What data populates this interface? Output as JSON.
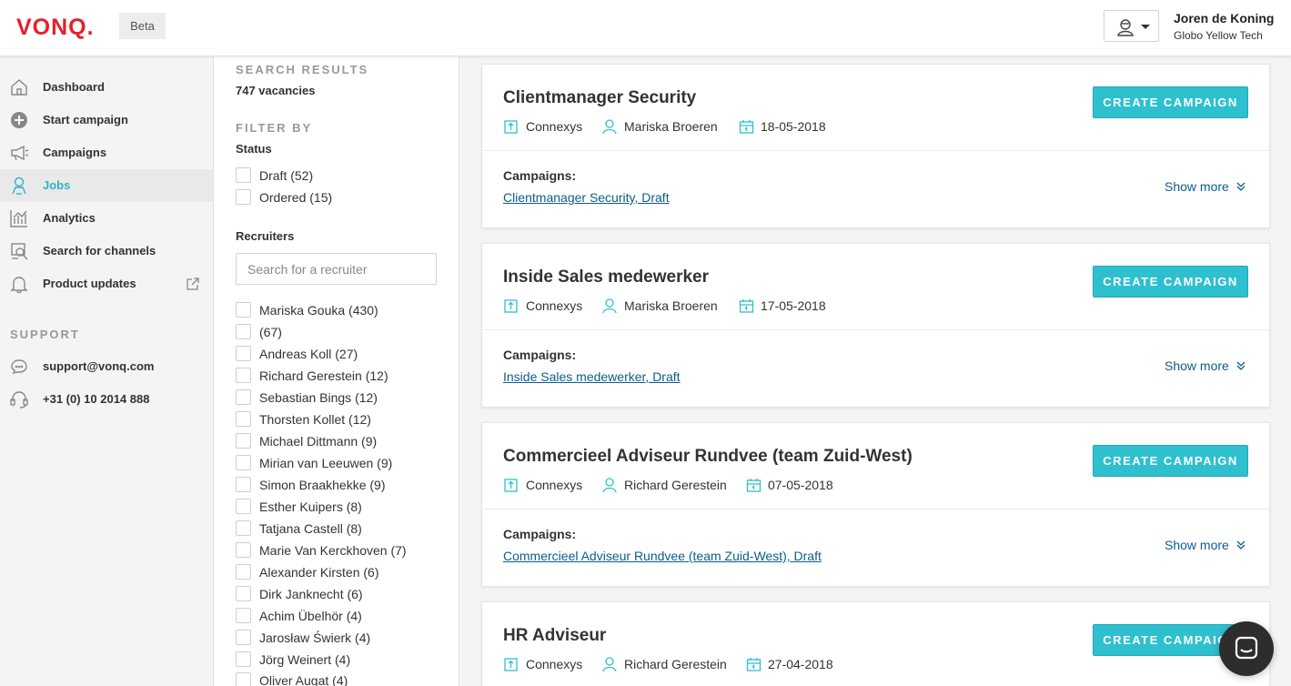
{
  "brand": {
    "logo": "VONQ.",
    "badge": "Beta"
  },
  "user": {
    "name": "Joren de Koning",
    "company": "Globo Yellow Tech"
  },
  "sidebar": {
    "items": [
      {
        "label": "Dashboard",
        "icon": "home-icon"
      },
      {
        "label": "Start campaign",
        "icon": "plus-circle-icon"
      },
      {
        "label": "Campaigns",
        "icon": "megaphone-icon"
      },
      {
        "label": "Jobs",
        "icon": "briefcase-person-icon",
        "active": true
      },
      {
        "label": "Analytics",
        "icon": "bar-chart-icon"
      },
      {
        "label": "Search for channels",
        "icon": "search-channels-icon"
      },
      {
        "label": "Product updates",
        "icon": "bell-icon"
      }
    ],
    "support_heading": "SUPPORT",
    "support_items": [
      {
        "label": "support@vonq.com",
        "icon": "chat-icon"
      },
      {
        "label": "+31 (0) 10 2014 888",
        "icon": "headset-icon"
      }
    ]
  },
  "filters": {
    "results_heading": "SEARCH RESULTS",
    "results_count": "747 vacancies",
    "filter_heading": "FILTER BY",
    "status_label": "Status",
    "status_options": [
      "Draft (52)",
      "Ordered (15)"
    ],
    "recruiters_label": "Recruiters",
    "recruiter_search_placeholder": "Search for a recruiter",
    "recruiters": [
      "Mariska Gouka (430)",
      "(67)",
      "Andreas Koll (27)",
      "Richard Gerestein (12)",
      "Sebastian Bings (12)",
      "Thorsten Kollet (12)",
      "Michael Dittmann (9)",
      "Mirian van Leeuwen (9)",
      "Simon Braakhekke (9)",
      "Esther Kuipers (8)",
      "Tatjana Castell (8)",
      "Marie Van Kerckhoven (7)",
      "Alexander Kirsten (6)",
      "Dirk Janknecht (6)",
      "Achim Übelhör (4)",
      "Jarosław Świerk (4)",
      "Jörg Weinert (4)",
      "Oliver Augat (4)"
    ]
  },
  "jobs": [
    {
      "title": "Clientmanager Security",
      "company": "Connexys",
      "recruiter": "Mariska Broeren",
      "date": "18-05-2018",
      "button": "CREATE CAMPAIGN",
      "campaigns_label": "Campaigns:",
      "campaign_link": "Clientmanager Security, Draft",
      "show_more": "Show more"
    },
    {
      "title": "Inside Sales medewerker",
      "company": "Connexys",
      "recruiter": "Mariska Broeren",
      "date": "17-05-2018",
      "button": "CREATE CAMPAIGN",
      "campaigns_label": "Campaigns:",
      "campaign_link": "Inside Sales medewerker, Draft",
      "show_more": "Show more"
    },
    {
      "title": "Commercieel Adviseur Rundvee (team Zuid-West)",
      "company": "Connexys",
      "recruiter": "Richard Gerestein",
      "date": "07-05-2018",
      "button": "CREATE CAMPAIGN",
      "campaigns_label": "Campaigns:",
      "campaign_link": "Commercieel Adviseur Rundvee (team Zuid-West), Draft",
      "show_more": "Show more"
    },
    {
      "title": "HR Adviseur",
      "company": "Connexys",
      "recruiter": "Richard Gerestein",
      "date": "27-04-2018",
      "button": "CREATE CAMPAIGN"
    }
  ],
  "colors": {
    "brand": "#e4202c",
    "accent": "#2ec0cf",
    "link": "#0c5d8c",
    "active_nav": "#2ab3c7"
  }
}
